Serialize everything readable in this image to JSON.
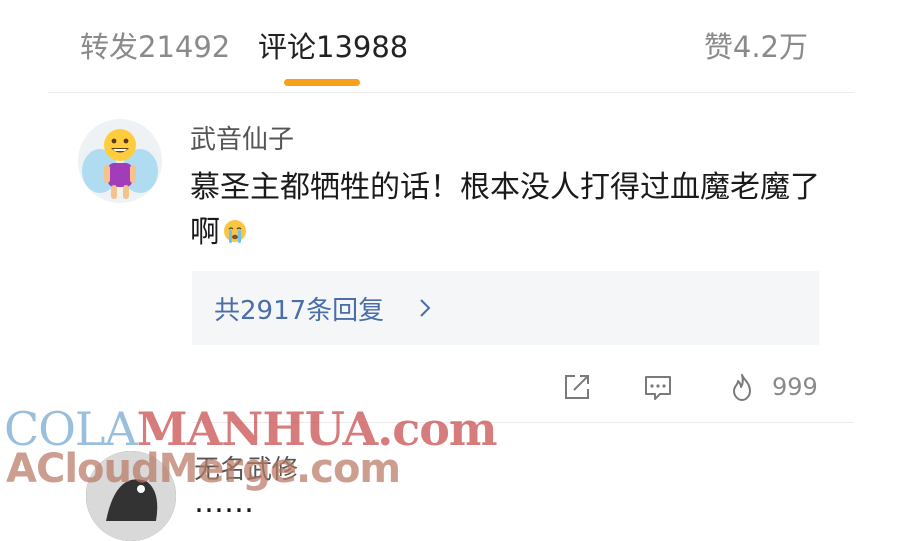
{
  "tabs": {
    "repost": "转发21492",
    "comment": "评论13988",
    "like": "赞4.2万",
    "accent_color": "#f7a11a"
  },
  "comment": {
    "username": "武音仙子",
    "text": "慕圣主都牺牲的话！根本没人打得过血魔老魔了啊",
    "emoji_icon": "crying-face-icon",
    "reply_summary": "共2917条回复",
    "like_count": "999",
    "link_color": "#4a6ea8"
  },
  "comment2": {
    "username": "无名武修",
    "text": "……"
  },
  "watermark": {
    "line1_part1": "COLA",
    "line1_part2": "MANHUA.com",
    "line2": "ACloudMerge.com"
  }
}
